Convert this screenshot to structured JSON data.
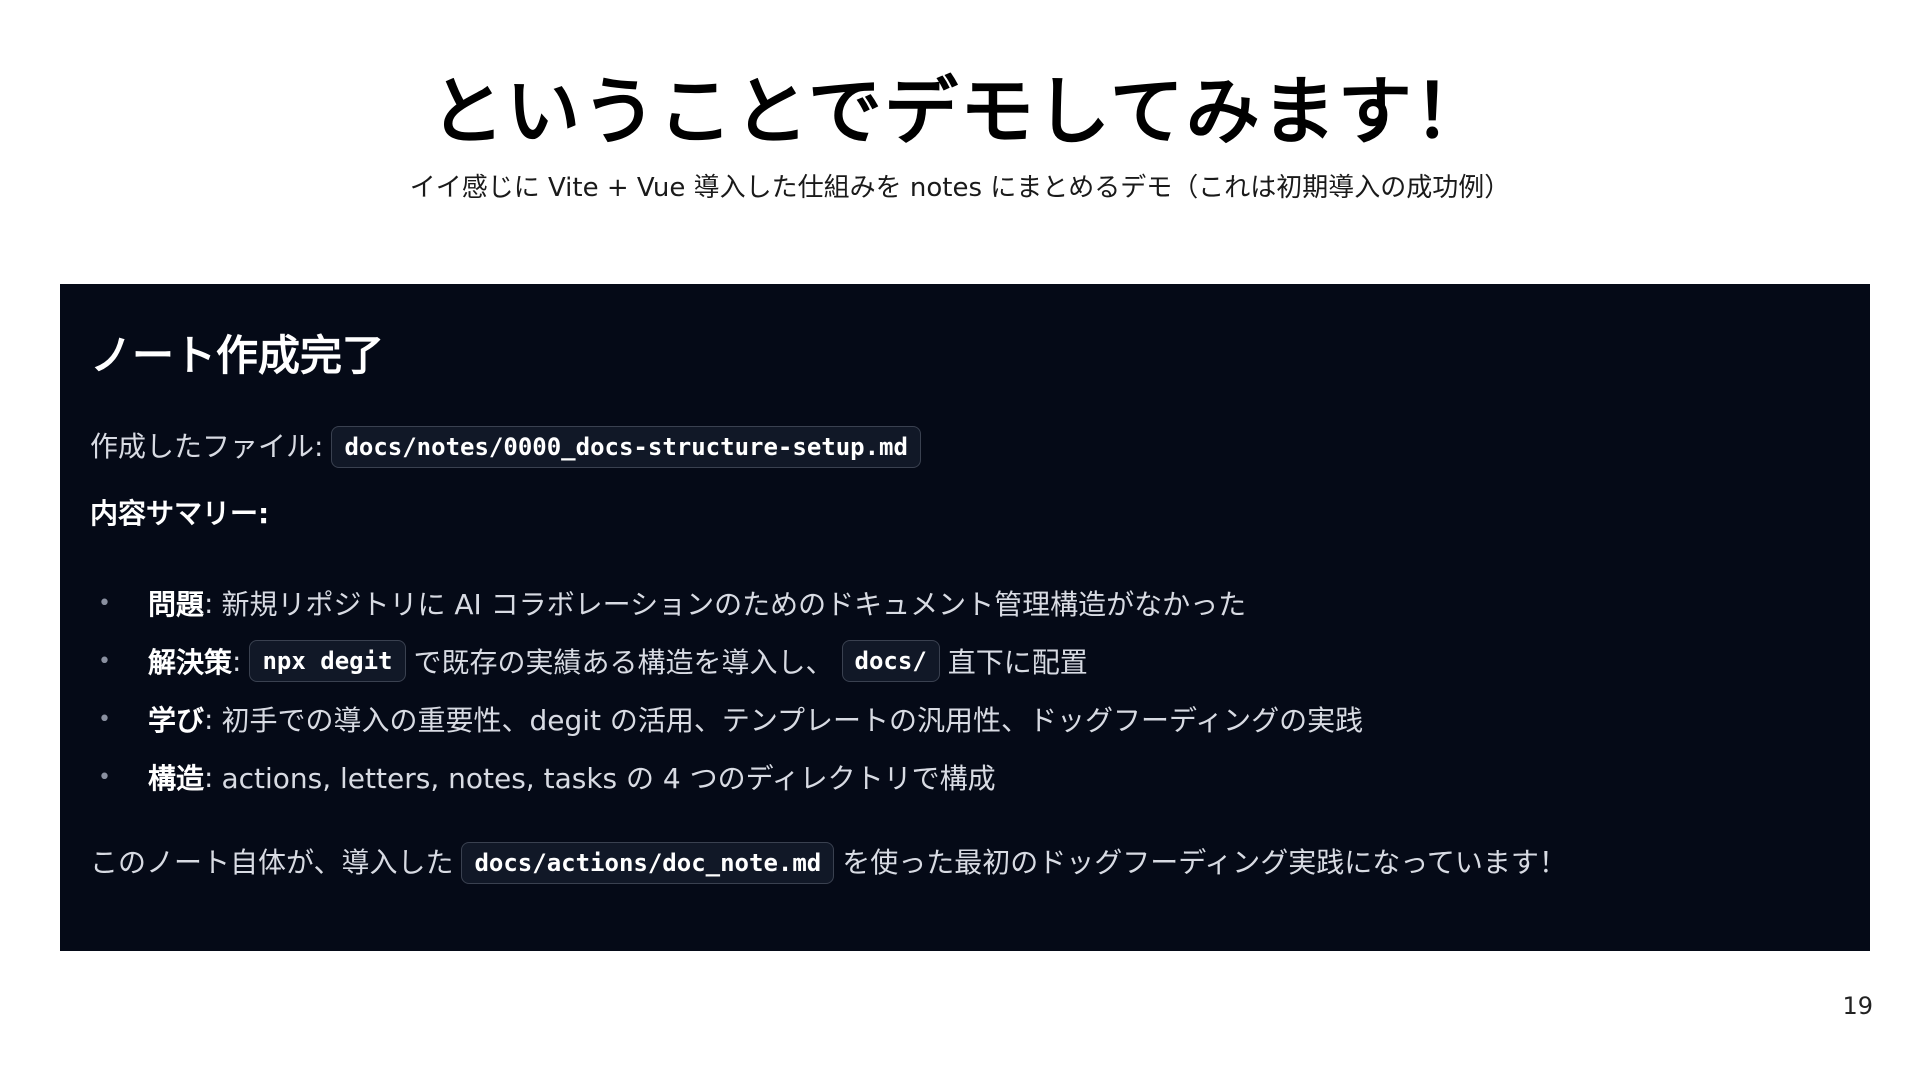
{
  "slide": {
    "title": "ということでデモしてみます！",
    "subtitle": "イイ感じに Vite + Vue 導入した仕組みを notes にまとめるデモ（これは初期導入の成功例）",
    "page_number": "19"
  },
  "screen": {
    "heading": "ノート作成完了",
    "file_label": "作成したファイル:",
    "file_path": "docs/notes/0000_docs-structure-setup.md",
    "summary_label": "内容サマリー:",
    "bullet_marker": "•",
    "bullets": [
      {
        "label": "問題",
        "sep": ":",
        "text": "新規リポジトリに AI コラボレーションのためのドキュメント管理構造がなかった"
      },
      {
        "label": "解決策",
        "sep": ":",
        "code1": "npx degit",
        "text1": "で既存の実績ある構造を導入し、",
        "code2": "docs/",
        "text2": "直下に配置"
      },
      {
        "label": "学び",
        "sep": ":",
        "text": "初手での導入の重要性、degit の活用、テンプレートの汎用性、ドッグフーディングの実践"
      },
      {
        "label": "構造",
        "sep": ":",
        "text": "actions, letters, notes, tasks の 4 つのディレクトリで構成"
      }
    ],
    "closing_pre": "このノート自体が、導入した",
    "closing_code": "docs/actions/doc_note.md",
    "closing_post": "を使った最初のドッグフーディング実践になっています！"
  },
  "colors": {
    "panel_background": "#050a17",
    "code_background": "#111827",
    "code_border": "#3a4150"
  }
}
